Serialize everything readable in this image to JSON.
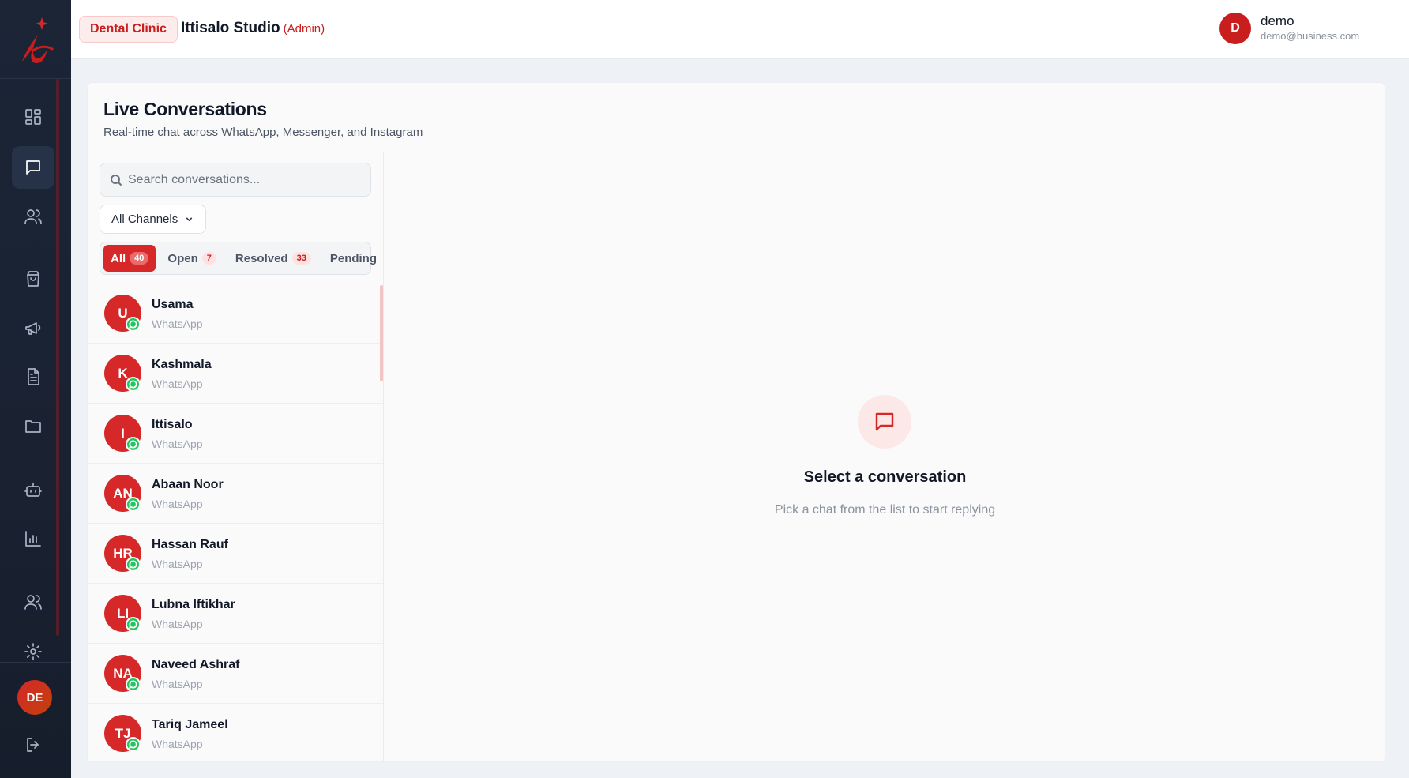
{
  "sidebar": {
    "logo_name": "ittisalo-logo",
    "items": [
      {
        "name": "dashboard",
        "icon": "grid-icon"
      },
      {
        "name": "conversations",
        "icon": "chat-icon",
        "active": true
      },
      {
        "name": "contacts",
        "icon": "users-icon"
      },
      {
        "name": "orders",
        "icon": "shopping-bag-icon"
      },
      {
        "name": "campaigns",
        "icon": "megaphone-icon"
      },
      {
        "name": "templates",
        "icon": "document-icon"
      },
      {
        "name": "files",
        "icon": "folder-icon"
      },
      {
        "name": "bots",
        "icon": "bot-icon"
      },
      {
        "name": "analytics",
        "icon": "bar-chart-icon"
      },
      {
        "name": "team",
        "icon": "team-icon"
      },
      {
        "name": "settings",
        "icon": "gear-icon"
      }
    ],
    "avatar_initials": "DE",
    "logout_icon": "logout-icon"
  },
  "topbar": {
    "clinic_badge": "Dental Clinic",
    "studio_name": "Ittisalo Studio",
    "role": "(Admin)",
    "user": {
      "initial": "D",
      "name": "demo",
      "email": "demo@business.com"
    }
  },
  "page": {
    "title": "Live Conversations",
    "subtitle": "Real-time chat across WhatsApp, Messenger, and Instagram"
  },
  "search": {
    "placeholder": "Search conversations...",
    "value": ""
  },
  "channel_filter": {
    "selected": "All Channels"
  },
  "tabs": [
    {
      "label": "All",
      "count": "40",
      "active": true
    },
    {
      "label": "Open",
      "count": "7"
    },
    {
      "label": "Resolved",
      "count": "33"
    },
    {
      "label": "Pending",
      "count": ""
    }
  ],
  "conversations": [
    {
      "initials": "U",
      "name": "Usama",
      "channel": "WhatsApp"
    },
    {
      "initials": "K",
      "name": "Kashmala",
      "channel": "WhatsApp"
    },
    {
      "initials": "I",
      "name": "Ittisalo",
      "channel": "WhatsApp"
    },
    {
      "initials": "AN",
      "name": "Abaan Noor",
      "channel": "WhatsApp"
    },
    {
      "initials": "HR",
      "name": "Hassan Rauf",
      "channel": "WhatsApp"
    },
    {
      "initials": "LI",
      "name": "Lubna Iftikhar",
      "channel": "WhatsApp"
    },
    {
      "initials": "NA",
      "name": "Naveed Ashraf",
      "channel": "WhatsApp"
    },
    {
      "initials": "TJ",
      "name": "Tariq Jameel",
      "channel": "WhatsApp"
    }
  ],
  "empty_state": {
    "title": "Select a conversation",
    "subtitle": "Pick a chat from the list to start replying"
  },
  "colors": {
    "accent": "#d62828",
    "sidebar_bg": "#1b2536",
    "whatsapp": "#22c55e"
  }
}
